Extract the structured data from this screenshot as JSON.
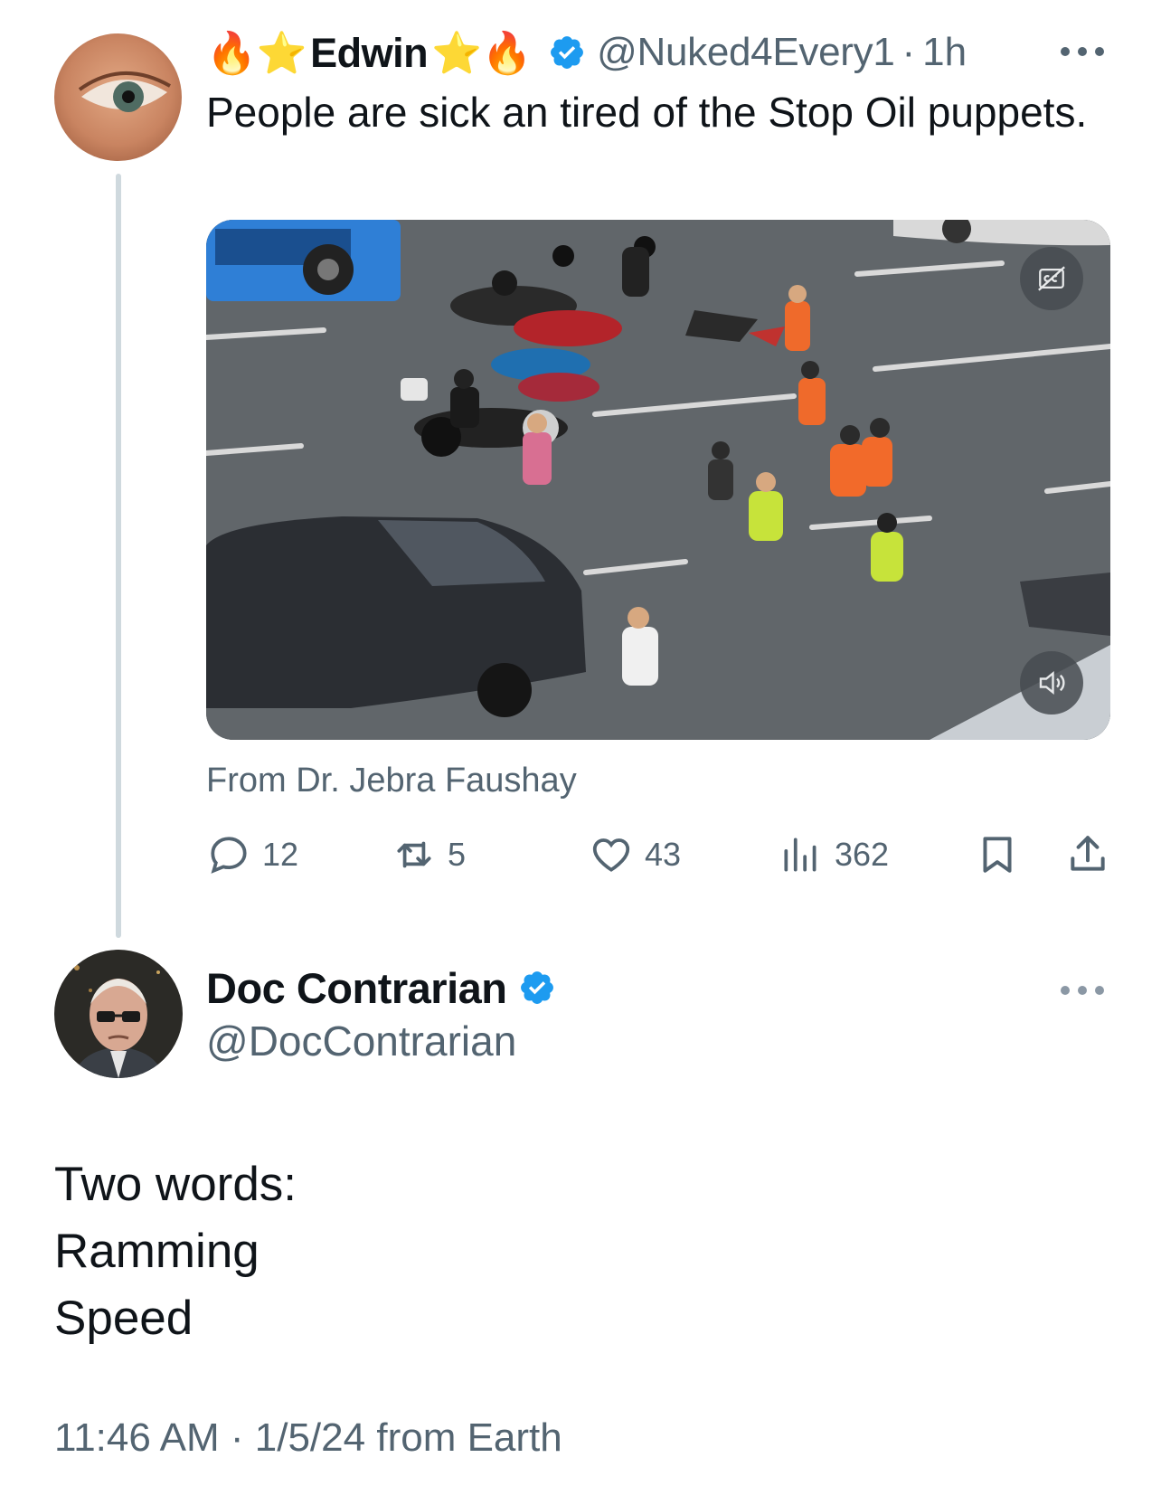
{
  "parent_tweet": {
    "display_name": "Edwin",
    "emoji_prefix": "🔥⭐",
    "emoji_suffix": "⭐🔥",
    "handle": "@Nuked4Every1",
    "separator": "·",
    "time": "1h",
    "text": "People are sick an tired of the Stop Oil puppets.",
    "media_source": "From Dr. Jebra Faushay",
    "stats": {
      "replies": "12",
      "reposts": "5",
      "likes": "43",
      "views": "362"
    }
  },
  "reply_tweet": {
    "display_name": "Doc Contrarian",
    "handle": "@DocContrarian",
    "body_lines": [
      "Two words:",
      "Ramming",
      "Speed"
    ],
    "timestamp": "11:46 AM",
    "separator": "·",
    "date": "1/5/24",
    "source": "from Earth"
  },
  "icons": {
    "verified": "verified-badge-icon",
    "reply": "reply-icon",
    "repost": "repost-icon",
    "like": "heart-icon",
    "views": "views-icon",
    "bookmark": "bookmark-icon",
    "share": "share-icon",
    "captions": "captions-off-icon",
    "mute": "volume-icon"
  },
  "colors": {
    "text_primary": "#0f1419",
    "text_secondary": "#536471",
    "verified_blue": "#1d9bf0",
    "thread_line": "#cfd9de"
  }
}
